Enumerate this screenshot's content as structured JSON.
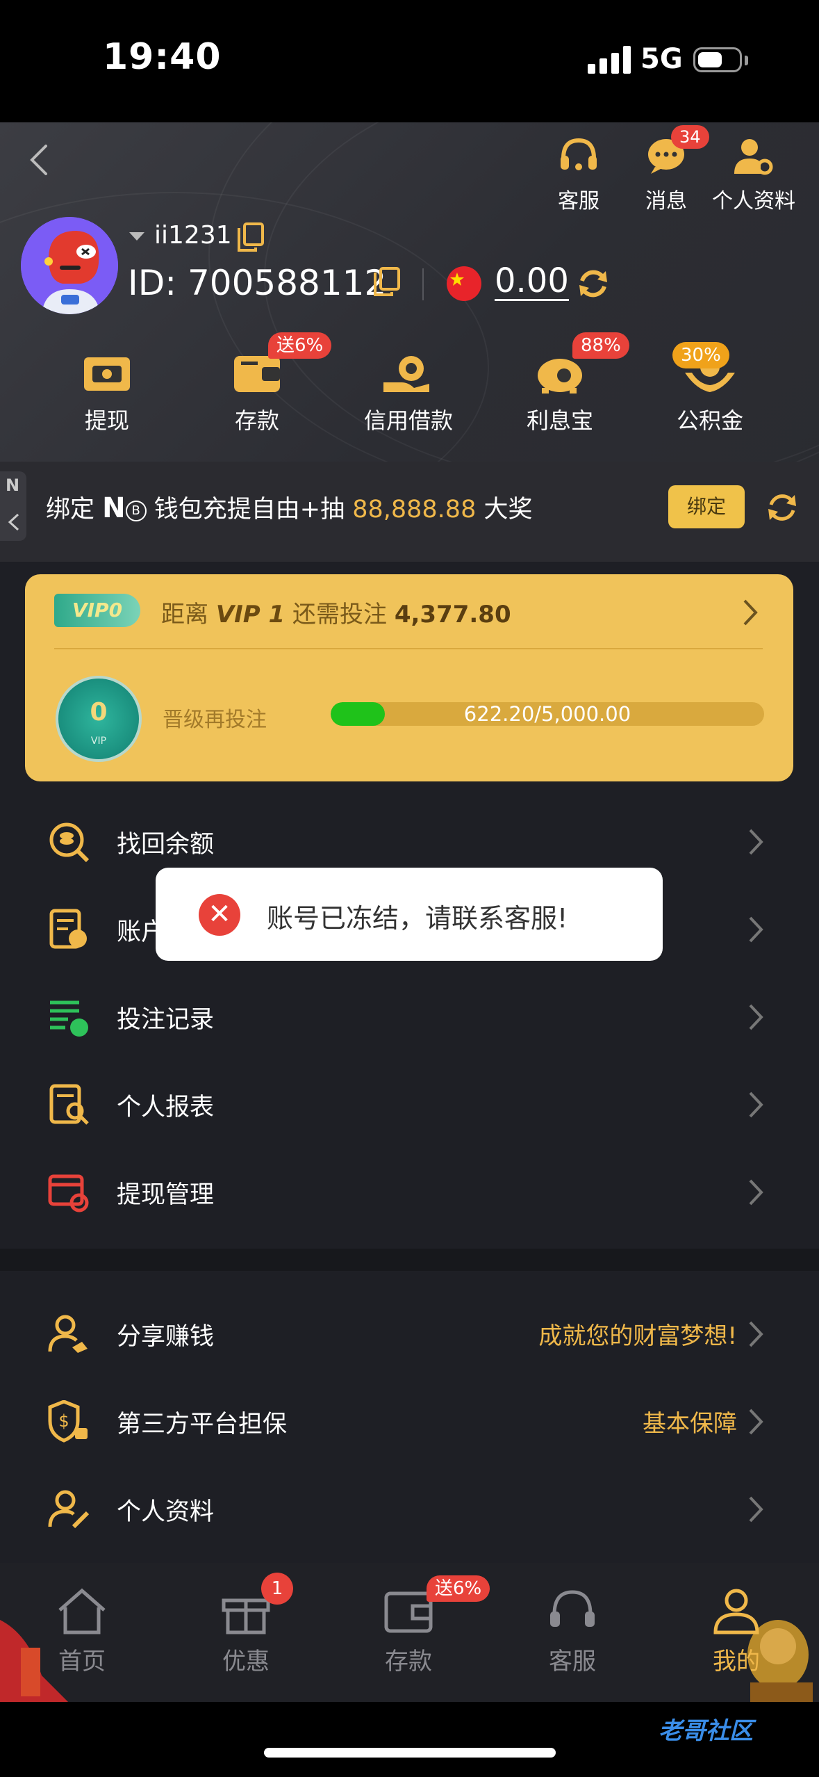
{
  "status_bar": {
    "time": "19:40",
    "network": "5G"
  },
  "header": {
    "top_icons": [
      {
        "label": "客服",
        "icon": "headset-icon"
      },
      {
        "label": "消息",
        "icon": "chat-icon",
        "badge": "34"
      },
      {
        "label": "个人资料",
        "icon": "user-gear-icon"
      }
    ],
    "username": "ii1231",
    "user_id": "ID: 700588112",
    "balance": "0.00",
    "quick_actions": [
      {
        "label": "提现",
        "icon": "withdraw-icon",
        "badge": ""
      },
      {
        "label": "存款",
        "icon": "wallet-icon",
        "badge": "送6%"
      },
      {
        "label": "信用借款",
        "icon": "credit-loan-icon",
        "badge": ""
      },
      {
        "label": "利息宝",
        "icon": "piggy-bank-icon",
        "badge": "88%"
      },
      {
        "label": "公积金",
        "icon": "fund-icon",
        "badge": "30%"
      }
    ]
  },
  "bind_bar": {
    "text_prefix": "绑定 ",
    "brand": "N",
    "text_middle": " 钱包充提自由+抽 ",
    "amount": "88,888.88",
    "text_suffix": " 大奖",
    "button": "绑定",
    "side_tab": "N"
  },
  "vip": {
    "badge": "VIP0",
    "distance_prefix": "距离 ",
    "next_level": "VIP 1",
    "distance_middle": " 还需投注 ",
    "distance_amount": "4,377.80",
    "medal_level": "0",
    "medal_caption": "VIP",
    "upgrade_label": "晋级再投注",
    "progress_text": "622.20/5,000.00",
    "progress_fraction": 0.1244
  },
  "menu1": [
    {
      "label": "找回余额",
      "icon": "coin-search-icon"
    },
    {
      "label": "账户",
      "icon": "account-details-icon"
    },
    {
      "label": "投注记录",
      "icon": "bet-record-icon"
    },
    {
      "label": "个人报表",
      "icon": "report-icon"
    },
    {
      "label": "提现管理",
      "icon": "withdraw-manage-icon"
    }
  ],
  "menu2": [
    {
      "label": "分享赚钱",
      "sub": "成就您的财富梦想!",
      "icon": "share-earn-icon"
    },
    {
      "label": "第三方平台担保",
      "sub": "基本保障",
      "icon": "guarantee-icon"
    },
    {
      "label": "个人资料",
      "sub": "",
      "icon": "profile-edit-icon"
    }
  ],
  "toast": {
    "message": "账号已冻结，请联系客服!"
  },
  "tabbar": [
    {
      "label": "首页",
      "icon": "home-icon",
      "badge": ""
    },
    {
      "label": "优惠",
      "icon": "gift-icon",
      "badge": "1"
    },
    {
      "label": "存款",
      "icon": "wallet-icon",
      "badge": "送6%"
    },
    {
      "label": "客服",
      "icon": "headset-icon",
      "badge": ""
    },
    {
      "label": "我的",
      "icon": "person-icon",
      "badge": ""
    }
  ],
  "watermark": "老哥社区",
  "colors": {
    "accent": "#f0b84a",
    "badge_red": "#e8423a",
    "vip_card": "#f0c35a",
    "progress": "#1fc21a",
    "bg": "#1e1f25"
  }
}
